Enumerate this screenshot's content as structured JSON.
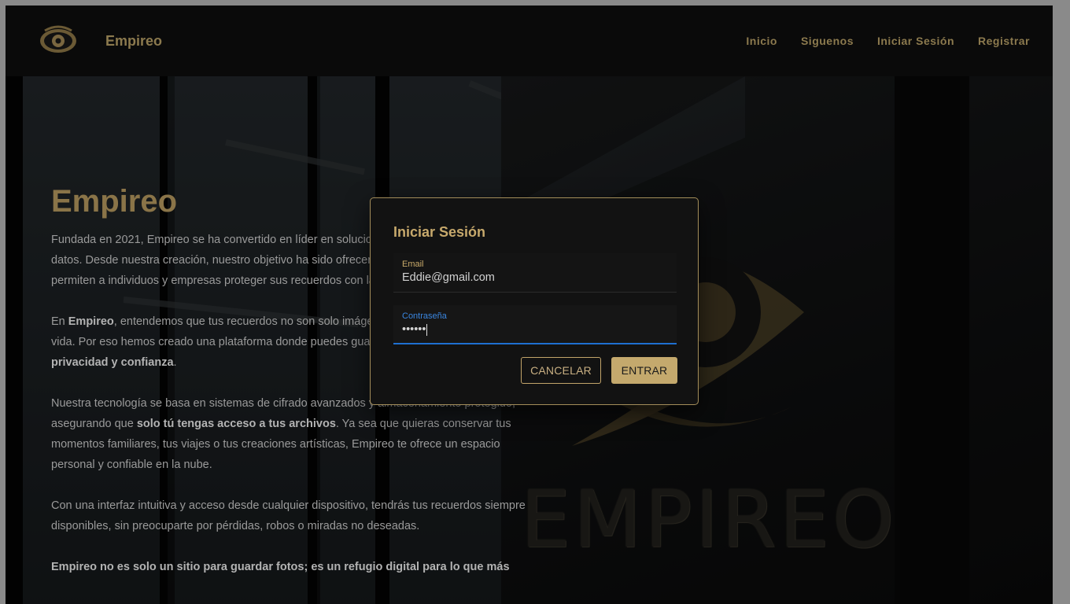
{
  "nav": {
    "brand": "Empireo",
    "links": [
      "Inicio",
      "Siguenos",
      "Iniciar Sesión",
      "Registrar"
    ]
  },
  "hero": {
    "title": "Empireo",
    "p1": "Fundada en 2021, Empireo se ha convertido en líder en soluciones de almacenamiento de datos. Desde nuestra creación, nuestro objetivo ha sido ofrecer servicios innovadores que permiten a individuos y empresas proteger sus recuerdos con la máxima seguridad y confianza.",
    "p2_pre": "En ",
    "p2_bold1": "Empireo",
    "p2_mid": ", entendemos que tus recuerdos no son solo imágenes, son momentos únicos de tu vida. Por eso hemos creado una plataforma donde puedes guardarlos con ",
    "p2_bold2": "seguridad, privacidad y confianza",
    "p2_end": ".",
    "p3_pre": "Nuestra tecnología se basa en sistemas de cifrado avanzados y almacenamiento protegido, asegurando que ",
    "p3_bold": "solo tú tengas acceso a tus archivos",
    "p3_end": ". Ya sea que quieras conservar tus momentos familiares, tus viajes o tus creaciones artísticas, Empireo te ofrece un espacio personal y confiable en la nube.",
    "p4": "Con una interfaz intuitiva y acceso desde cualquier dispositivo, tendrás tus recuerdos siempre disponibles, sin preocuparte por pérdidas, robos o miradas no deseadas.",
    "p5_bold": "Empireo no es solo un sitio para guardar fotos; es un refugio digital para lo que más"
  },
  "background": {
    "wordmark": "EMPIREO"
  },
  "modal": {
    "title": "Iniciar Sesión",
    "email_label": "Email",
    "email_value": "Eddie@gmail.com",
    "password_label": "Contraseña",
    "password_value": "••••••",
    "cancel_label": "CANCELAR",
    "enter_label": "ENTRAR"
  },
  "colors": {
    "accent": "#c4a96d",
    "focus": "#1e6fd0"
  }
}
